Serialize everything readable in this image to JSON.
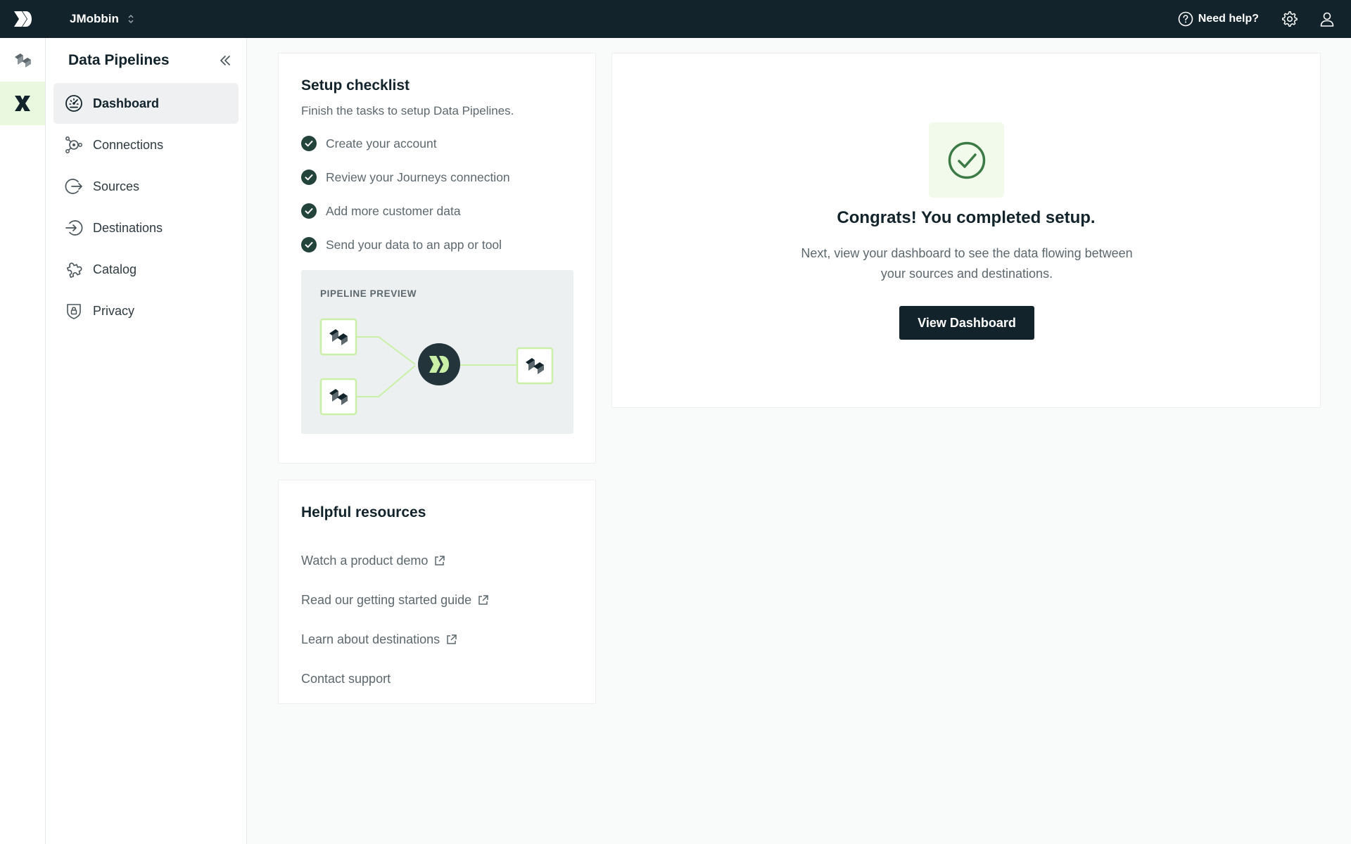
{
  "topbar": {
    "workspace": "JMobbin",
    "help_label": "Need help?"
  },
  "sidenav": {
    "title": "Data Pipelines",
    "items": [
      {
        "label": "Dashboard",
        "icon": "gauge-icon",
        "active": true
      },
      {
        "label": "Connections",
        "icon": "connections-icon"
      },
      {
        "label": "Sources",
        "icon": "sources-icon"
      },
      {
        "label": "Destinations",
        "icon": "destinations-icon"
      },
      {
        "label": "Catalog",
        "icon": "puzzle-icon"
      },
      {
        "label": "Privacy",
        "icon": "shield-lock-icon"
      }
    ]
  },
  "checklist": {
    "title": "Setup checklist",
    "subtitle": "Finish the tasks to setup Data Pipelines.",
    "tasks": [
      "Create your account",
      "Review your Journeys connection",
      "Add more customer data",
      "Send your data to an app or tool"
    ],
    "preview_label": "PIPELINE PREVIEW"
  },
  "resources": {
    "title": "Helpful resources",
    "items": [
      "Watch a product demo",
      "Read our getting started guide",
      "Learn about destinations",
      "Contact support"
    ]
  },
  "congrats": {
    "title": "Congrats! You completed setup.",
    "text": "Next, view your dashboard to see the data flowing between your sources and destinations.",
    "button": "View Dashboard"
  },
  "colors": {
    "topbar_bg": "#13232b",
    "accent_green": "#3b7a45",
    "check_dark": "#23443a",
    "preview_line": "#c9f0a6",
    "active_rail": "#e9f8df"
  }
}
